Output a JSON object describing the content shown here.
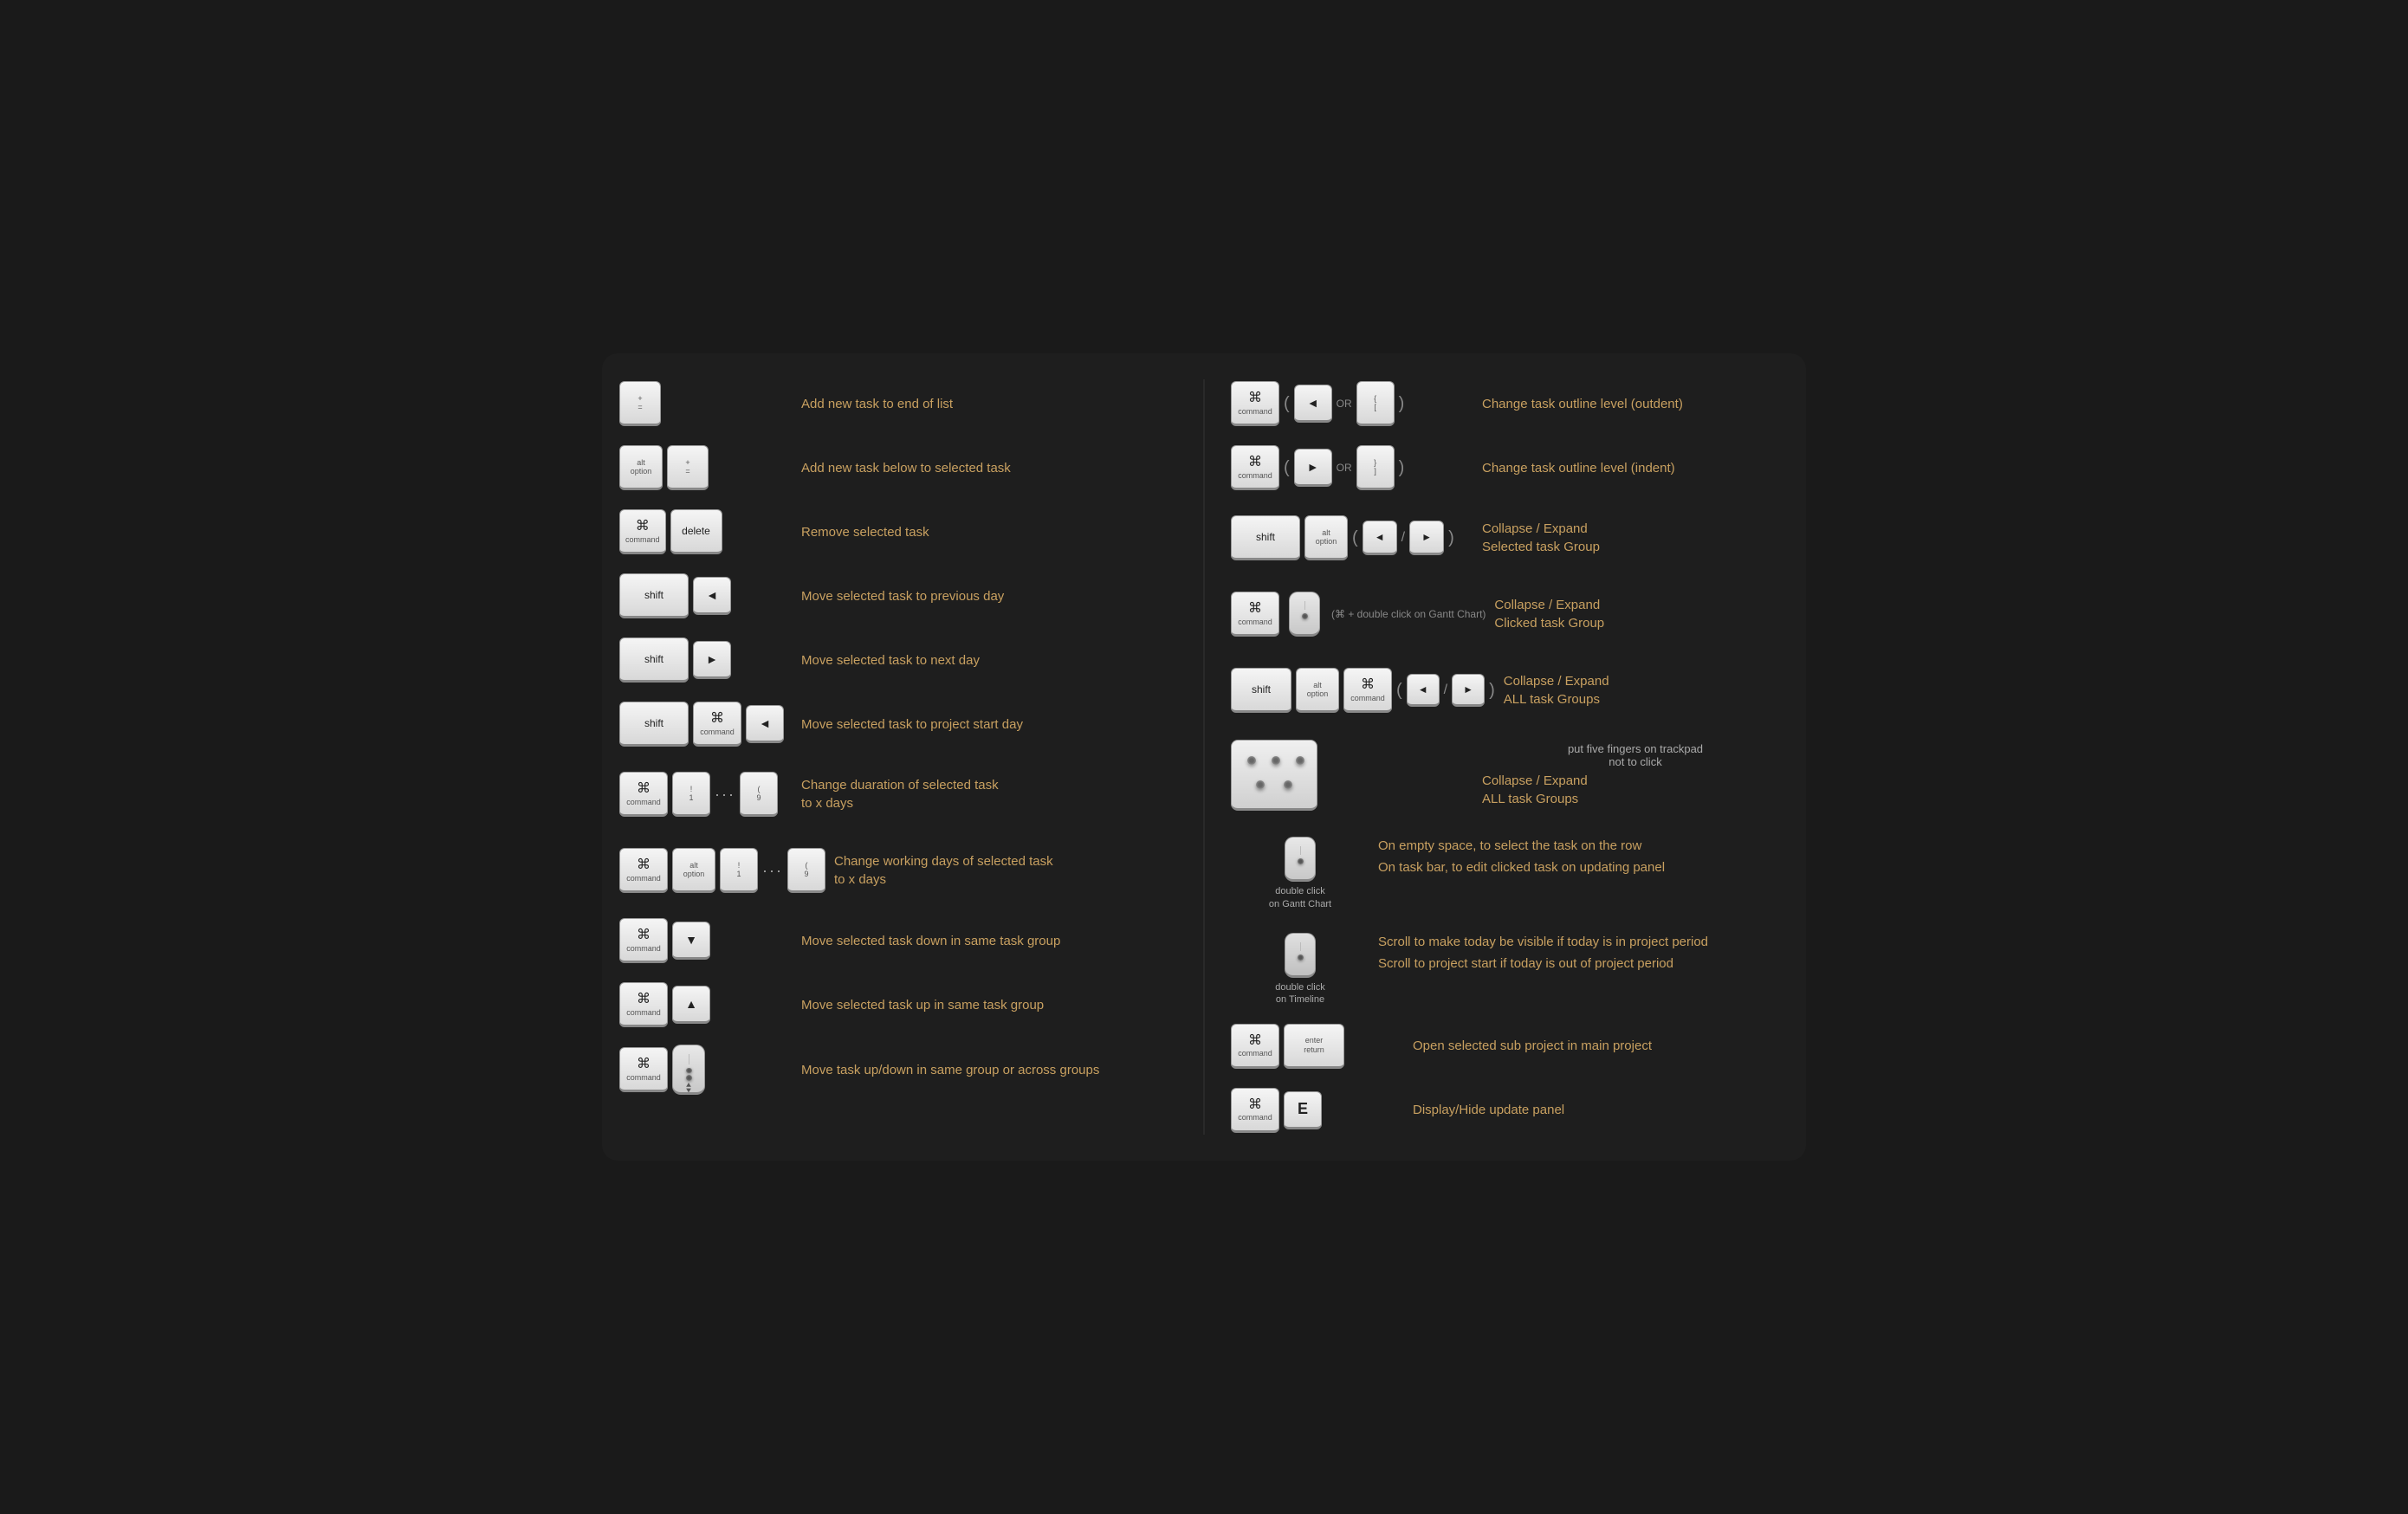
{
  "left": {
    "rows": [
      {
        "id": "add-end",
        "keys": [
          {
            "label": "+",
            "sub": "=",
            "type": "stacked"
          }
        ],
        "desc": "Add new task to end of list"
      },
      {
        "id": "add-below",
        "keys": [
          {
            "type": "alt-option"
          },
          {
            "label": "+",
            "sub": "=",
            "type": "stacked"
          }
        ],
        "desc": "Add new task below to selected task"
      },
      {
        "id": "remove",
        "keys": [
          {
            "type": "cmd"
          },
          {
            "label": "delete",
            "type": "plain"
          }
        ],
        "desc": "Remove selected task"
      },
      {
        "id": "prev-day",
        "keys": [
          {
            "label": "shift",
            "type": "plain-wide"
          },
          {
            "label": "◄",
            "type": "arrow"
          }
        ],
        "desc": "Move selected task to previous day"
      },
      {
        "id": "next-day",
        "keys": [
          {
            "label": "shift",
            "type": "plain-wide"
          },
          {
            "label": "►",
            "type": "arrow"
          }
        ],
        "desc": "Move selected task to next day"
      },
      {
        "id": "project-start",
        "keys": [
          {
            "label": "shift",
            "type": "plain-wide"
          },
          {
            "type": "cmd"
          },
          {
            "label": "◄",
            "type": "arrow"
          }
        ],
        "desc": "Move selected task to project start day"
      },
      {
        "id": "duration",
        "keys": [
          {
            "type": "cmd"
          },
          {
            "label": "!",
            "sub": "1",
            "type": "excl"
          },
          {
            "type": "dots"
          },
          {
            "label": "(",
            "sub": "9",
            "type": "paren-key"
          }
        ],
        "desc": "Change duaration of selected task\nto x days"
      },
      {
        "id": "working-days",
        "keys": [
          {
            "type": "cmd"
          },
          {
            "type": "alt-option-small"
          },
          {
            "label": "!",
            "sub": "1",
            "type": "excl"
          },
          {
            "type": "dots"
          },
          {
            "label": "(",
            "sub": "9",
            "type": "paren-key"
          }
        ],
        "desc": "Change working days of selected task\nto x days"
      },
      {
        "id": "move-down",
        "keys": [
          {
            "type": "cmd"
          },
          {
            "label": "▼",
            "type": "arrow"
          }
        ],
        "desc": "Move selected task down in same task group"
      },
      {
        "id": "move-up",
        "keys": [
          {
            "type": "cmd"
          },
          {
            "label": "▲",
            "type": "arrow"
          }
        ],
        "desc": "Move selected task up in same task group"
      },
      {
        "id": "move-mouse",
        "keys": [
          {
            "type": "cmd"
          },
          {
            "type": "mouse-drag"
          }
        ],
        "desc": "Move task up/down in same group or across groups"
      }
    ]
  },
  "right": {
    "rows": [
      {
        "id": "outdent",
        "desc": "Change task outline level (outdent)"
      },
      {
        "id": "indent",
        "desc": "Change task outline level (indent)"
      },
      {
        "id": "collapse-expand-group",
        "desc": "Collapse / Expand\nSelected task Group"
      },
      {
        "id": "collapse-gantt",
        "desc": "Collapse / Expand\nClicked task Group"
      },
      {
        "id": "collapse-all",
        "desc": "Collapse / Expand\nALL task Groups"
      },
      {
        "id": "collapse-trackpad",
        "desc": "Collapse / Expand\nALL task Groups"
      },
      {
        "id": "dbl-gantt",
        "label": "double click\non Gantt Chart",
        "desc1": "On empty space, to select the task on the row",
        "desc2": "On task bar,  to edit clicked task on updating panel"
      },
      {
        "id": "dbl-timeline",
        "label": "double click\non Timeline",
        "desc1": "Scroll to make today be visible if today is in project period",
        "desc2": "Scroll to project start if today is out of project period"
      },
      {
        "id": "open-sub",
        "desc": "Open selected sub project in main project"
      },
      {
        "id": "display-hide",
        "desc": "Display/Hide update panel"
      }
    ]
  }
}
